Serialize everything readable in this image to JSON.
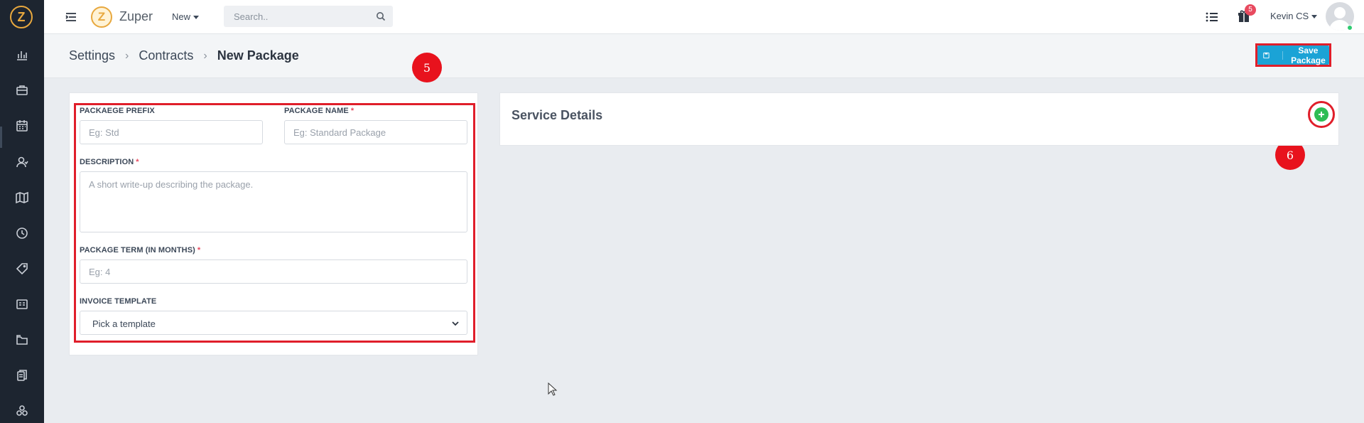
{
  "app": {
    "brand_name": "Zuper",
    "logo_letter": "Z",
    "accent_color": "#1ba3d6",
    "highlight_color": "#e01e2a"
  },
  "sidebar": {
    "items": [
      {
        "icon": "bar-chart-icon"
      },
      {
        "icon": "briefcase-icon"
      },
      {
        "icon": "calendar-icon"
      },
      {
        "icon": "users-icon"
      },
      {
        "icon": "map-icon"
      },
      {
        "icon": "clock-icon"
      },
      {
        "icon": "tag-icon"
      },
      {
        "icon": "invoice-icon"
      },
      {
        "icon": "folder-icon"
      },
      {
        "icon": "documents-icon"
      },
      {
        "icon": "cubes-icon"
      }
    ]
  },
  "topbar": {
    "new_label": "New",
    "search_placeholder": "Search..",
    "notification_count": "5",
    "user_name": "Kevin CS"
  },
  "page_header": {
    "breadcrumb": [
      "Settings",
      "Contracts",
      "New Package"
    ],
    "separator": "›",
    "save_label": "Save Package"
  },
  "annotations": {
    "step_a": "5",
    "step_b": "6"
  },
  "form": {
    "prefix_label": "PACKAEGE PREFIX",
    "prefix_placeholder": "Eg: Std",
    "name_label": "PACKAGE NAME",
    "name_placeholder": "Eg: Standard Package",
    "description_label": "DESCRIPTION",
    "description_placeholder": "A short write-up describing the package.",
    "term_label": "PACKAGE TERM (IN MONTHS)",
    "term_placeholder": "Eg: 4",
    "invoice_label": "INVOICE TEMPLATE",
    "invoice_selected": "Pick a template",
    "required_mark": "*"
  },
  "service_details": {
    "title": "Service Details"
  }
}
